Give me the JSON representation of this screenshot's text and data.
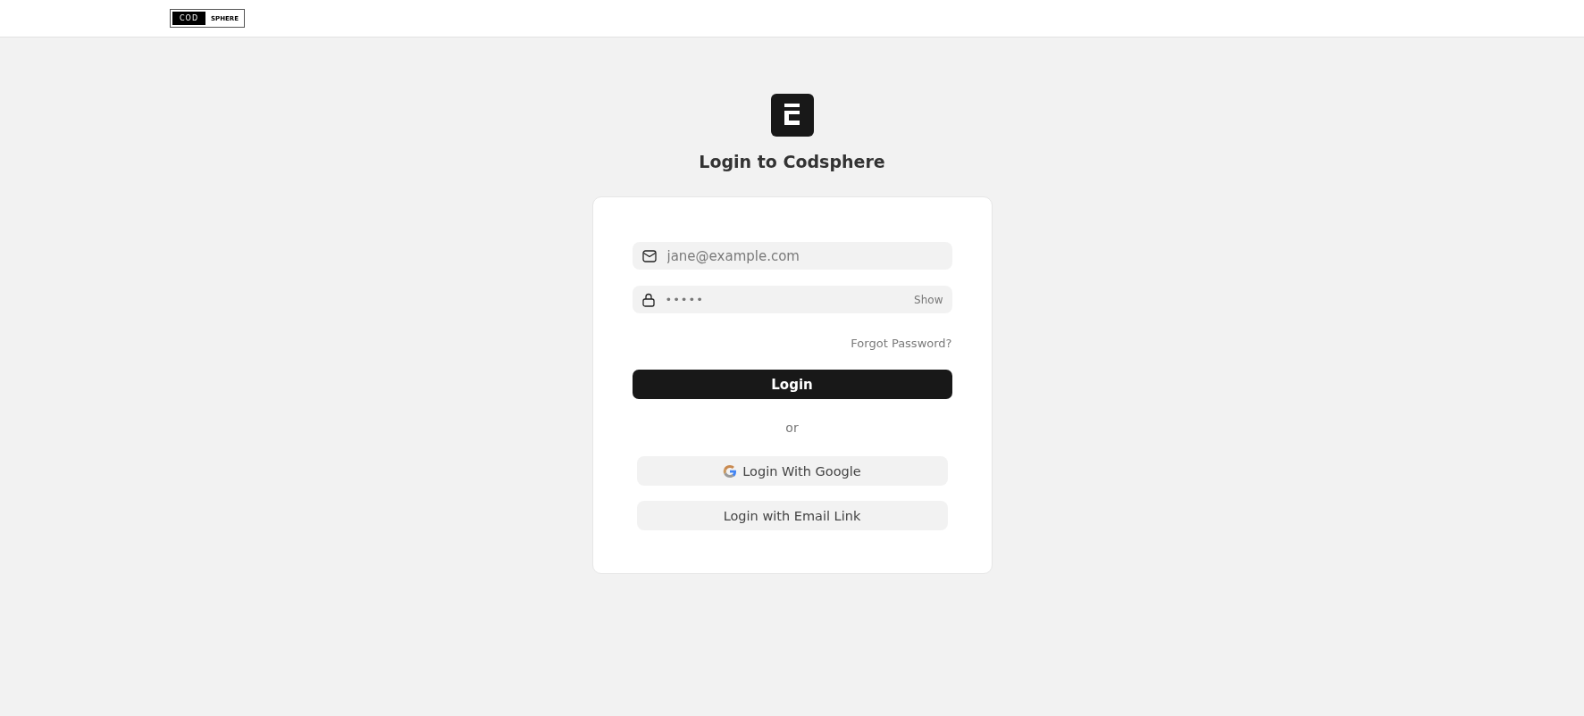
{
  "header": {
    "logo": [
      "COD",
      "SPHERE"
    ]
  },
  "title": "Login to Codsphere",
  "email": {
    "placeholder": "jane@example.com"
  },
  "password": {
    "value": "•••••",
    "toggle": "Show"
  },
  "forgot": "Forgot Password?",
  "submit": "Login",
  "separator": "or",
  "alternatives": [
    {
      "kind": "google",
      "label": "Login With Google"
    },
    {
      "kind": "plain",
      "label": "Login with Email Link"
    }
  ]
}
